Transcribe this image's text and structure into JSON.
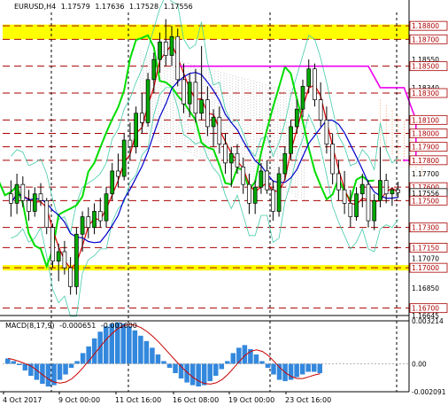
{
  "header": {
    "symbol": "EURUSD,H4",
    "ohlc": [
      "1.17579",
      "1.17636",
      "1.17528",
      "1.17556"
    ]
  },
  "macd_header": {
    "label": "MACD(8,17,9)",
    "values": [
      "-0.000651",
      "-0.001000"
    ]
  },
  "colors": {
    "bg": "#ffffff",
    "bull_body": "#00aa00",
    "bear_body": "#ffffff",
    "candle_wick": "#000000",
    "zone_fill": "#ffff00",
    "level_dash": "#aa0000",
    "green_line": "#00dd00",
    "red_line": "#dd0000",
    "blue_line": "#0000cc",
    "magenta_line": "#ee00ee",
    "band_line": "#44ccaa",
    "cloud_dots": "#c8c8c8",
    "cloud_dots_orange": "#ffa060",
    "macd_hist": "#3388dd",
    "macd_signal": "#cc0000",
    "current_price_bg": "#ffffff"
  },
  "price_axis": {
    "labels": [
      {
        "text": "1.18800",
        "value": 1.188,
        "box": true
      },
      {
        "text": "1.18700",
        "value": 1.187,
        "box": true
      },
      {
        "text": "1.18550",
        "value": 1.1855,
        "box": false
      },
      {
        "text": "1.18500",
        "value": 1.185,
        "box": true
      },
      {
        "text": "1.18340",
        "value": 1.1834,
        "box": false
      },
      {
        "text": "1.18300",
        "value": 1.183,
        "box": true
      },
      {
        "text": "1.18100",
        "value": 1.181,
        "box": true
      },
      {
        "text": "1.18000",
        "value": 1.18,
        "box": true
      },
      {
        "text": "1.17900",
        "value": 1.179,
        "box": true
      },
      {
        "text": "1.17800",
        "value": 1.178,
        "box": true
      },
      {
        "text": "1.17700",
        "value": 1.177,
        "box": false
      },
      {
        "text": "1.17600",
        "value": 1.176,
        "box": true
      },
      {
        "text": "1.17556",
        "value": 1.17556,
        "box": true
      },
      {
        "text": "1.17500",
        "value": 1.175,
        "box": true
      },
      {
        "text": "1.17300",
        "value": 1.173,
        "box": true
      },
      {
        "text": "1.17150",
        "value": 1.1715,
        "box": true
      },
      {
        "text": "1.17070",
        "value": 1.1707,
        "box": false
      },
      {
        "text": "1.17000",
        "value": 1.17,
        "box": true
      },
      {
        "text": "1.16850",
        "value": 1.1685,
        "box": false
      },
      {
        "text": "1.16700",
        "value": 1.167,
        "box": true
      },
      {
        "text": "1.16645",
        "value": 1.16645,
        "box": false
      }
    ],
    "top_clip": "1.18760"
  },
  "levels": [
    1.188,
    1.187,
    1.185,
    1.183,
    1.181,
    1.18,
    1.179,
    1.178,
    1.176,
    1.175,
    1.173,
    1.1715,
    1.17,
    1.167
  ],
  "zones": [
    {
      "from": 1.187,
      "to": 1.1881
    },
    {
      "from": 1.1698,
      "to": 1.1702
    }
  ],
  "time_axis": {
    "labels": [
      "4 Oct 2017",
      "9 Oct 00:00",
      "11 Oct 16:00",
      "16 Oct 08:00",
      "19 Oct 00:00",
      "23 Oct 16:00"
    ]
  },
  "macd_axis": {
    "labels": [
      "0.003214",
      "0.00",
      "-0.002091"
    ]
  },
  "chart_data": {
    "type": "candlestick",
    "symbol": "EURUSD,H4",
    "ylim": [
      1.16645,
      1.189
    ],
    "candles": [
      [
        1.1755,
        1.1765,
        1.1738,
        1.1748
      ],
      [
        1.1748,
        1.177,
        1.174,
        1.1762
      ],
      [
        1.1762,
        1.1768,
        1.1745,
        1.175
      ],
      [
        1.175,
        1.1758,
        1.1735,
        1.1742
      ],
      [
        1.1742,
        1.176,
        1.1738,
        1.1755
      ],
      [
        1.1755,
        1.1763,
        1.1746,
        1.175
      ],
      [
        1.175,
        1.1752,
        1.1725,
        1.173
      ],
      [
        1.173,
        1.1733,
        1.17,
        1.1705
      ],
      [
        1.1705,
        1.1718,
        1.169,
        1.1712
      ],
      [
        1.1712,
        1.172,
        1.1695,
        1.17
      ],
      [
        1.17,
        1.1708,
        1.168,
        1.1686
      ],
      [
        1.1686,
        1.173,
        1.168,
        1.1725
      ],
      [
        1.1725,
        1.1742,
        1.1712,
        1.1738
      ],
      [
        1.1738,
        1.1745,
        1.1722,
        1.173
      ],
      [
        1.173,
        1.1748,
        1.1725,
        1.1742
      ],
      [
        1.1742,
        1.1752,
        1.173,
        1.1735
      ],
      [
        1.1735,
        1.176,
        1.173,
        1.1755
      ],
      [
        1.1755,
        1.1778,
        1.175,
        1.1772
      ],
      [
        1.1772,
        1.1785,
        1.176,
        1.1768
      ],
      [
        1.1768,
        1.18,
        1.1765,
        1.1795
      ],
      [
        1.1795,
        1.1808,
        1.178,
        1.179
      ],
      [
        1.179,
        1.182,
        1.1785,
        1.1815
      ],
      [
        1.1815,
        1.183,
        1.18,
        1.1808
      ],
      [
        1.1808,
        1.1845,
        1.1805,
        1.184
      ],
      [
        1.184,
        1.186,
        1.183,
        1.1855
      ],
      [
        1.1855,
        1.1875,
        1.1845,
        1.1868
      ],
      [
        1.1868,
        1.1885,
        1.185,
        1.1858
      ],
      [
        1.1858,
        1.188,
        1.185,
        1.1872
      ],
      [
        1.1872,
        1.1878,
        1.1835,
        1.184
      ],
      [
        1.184,
        1.1852,
        1.1815,
        1.1822
      ],
      [
        1.1822,
        1.1845,
        1.1812,
        1.1838
      ],
      [
        1.1838,
        1.1848,
        1.1808,
        1.1815
      ],
      [
        1.1815,
        1.1865,
        1.181,
        1.1825
      ],
      [
        1.1825,
        1.1835,
        1.1798,
        1.1805
      ],
      [
        1.1805,
        1.1818,
        1.179,
        1.1812
      ],
      [
        1.1812,
        1.182,
        1.1785,
        1.1792
      ],
      [
        1.1792,
        1.18,
        1.177,
        1.1778
      ],
      [
        1.1778,
        1.179,
        1.176,
        1.1785
      ],
      [
        1.1785,
        1.1792,
        1.177,
        1.1775
      ],
      [
        1.1775,
        1.1782,
        1.1755,
        1.1762
      ],
      [
        1.1762,
        1.177,
        1.174,
        1.1748
      ],
      [
        1.1748,
        1.1765,
        1.174,
        1.176
      ],
      [
        1.176,
        1.1778,
        1.1755,
        1.1772
      ],
      [
        1.1772,
        1.178,
        1.1755,
        1.1758
      ],
      [
        1.1758,
        1.1765,
        1.1735,
        1.1742
      ],
      [
        1.1742,
        1.1775,
        1.1738,
        1.177
      ],
      [
        1.177,
        1.179,
        1.1765,
        1.1785
      ],
      [
        1.1785,
        1.181,
        1.178,
        1.1805
      ],
      [
        1.1805,
        1.1825,
        1.18,
        1.1818
      ],
      [
        1.1818,
        1.184,
        1.1812,
        1.1835
      ],
      [
        1.1835,
        1.1855,
        1.183,
        1.1848
      ],
      [
        1.1848,
        1.1852,
        1.182,
        1.1825
      ],
      [
        1.1825,
        1.1838,
        1.1805,
        1.181
      ],
      [
        1.181,
        1.182,
        1.1785,
        1.1792
      ],
      [
        1.1792,
        1.18,
        1.1762,
        1.177
      ],
      [
        1.177,
        1.178,
        1.175,
        1.1758
      ],
      [
        1.1758,
        1.1772,
        1.174,
        1.1748
      ],
      [
        1.1748,
        1.1758,
        1.173,
        1.1738
      ],
      [
        1.1738,
        1.176,
        1.1735,
        1.1755
      ],
      [
        1.1755,
        1.177,
        1.1745,
        1.1762
      ],
      [
        1.1762,
        1.1765,
        1.173,
        1.1735
      ],
      [
        1.1735,
        1.1755,
        1.1728,
        1.175
      ],
      [
        1.175,
        1.179,
        1.1745,
        1.1765
      ],
      [
        1.1765,
        1.177,
        1.1748,
        1.1755
      ],
      [
        1.1755,
        1.176,
        1.1746,
        1.1758
      ],
      [
        1.1758,
        1.1764,
        1.1752,
        1.1756
      ]
    ],
    "series": [
      {
        "name": "",
        "color": "green_line"
      },
      {
        "name": "",
        "color": "red_line"
      },
      {
        "name": "",
        "color": "blue_line"
      },
      {
        "name": "",
        "color": "magenta_line"
      }
    ],
    "macd_hist": [
      0.0004,
      0.0002,
      -0.0001,
      -0.0005,
      -0.0009,
      -0.0012,
      -0.0015,
      -0.0017,
      -0.0016,
      -0.0012,
      -0.0008,
      -0.0003,
      0.0002,
      0.0008,
      0.0013,
      0.0019,
      0.0024,
      0.0028,
      0.003,
      0.0031,
      0.003,
      0.0028,
      0.0025,
      0.0021,
      0.0017,
      0.0012,
      0.0007,
      0.0002,
      -0.0003,
      -0.0007,
      -0.0011,
      -0.0014,
      -0.0016,
      -0.0017,
      -0.0016,
      -0.0013,
      -0.0009,
      -0.0004,
      0.0002,
      0.0008,
      0.0012,
      0.0014,
      0.0011,
      0.0007,
      0.0002,
      -0.0003,
      -0.0008,
      -0.0012,
      -0.0013,
      -0.0012,
      -0.001,
      -0.0008,
      -0.0006,
      -0.0006,
      -0.0007
    ],
    "macd_range": [
      -0.002091,
      0.003214
    ]
  }
}
